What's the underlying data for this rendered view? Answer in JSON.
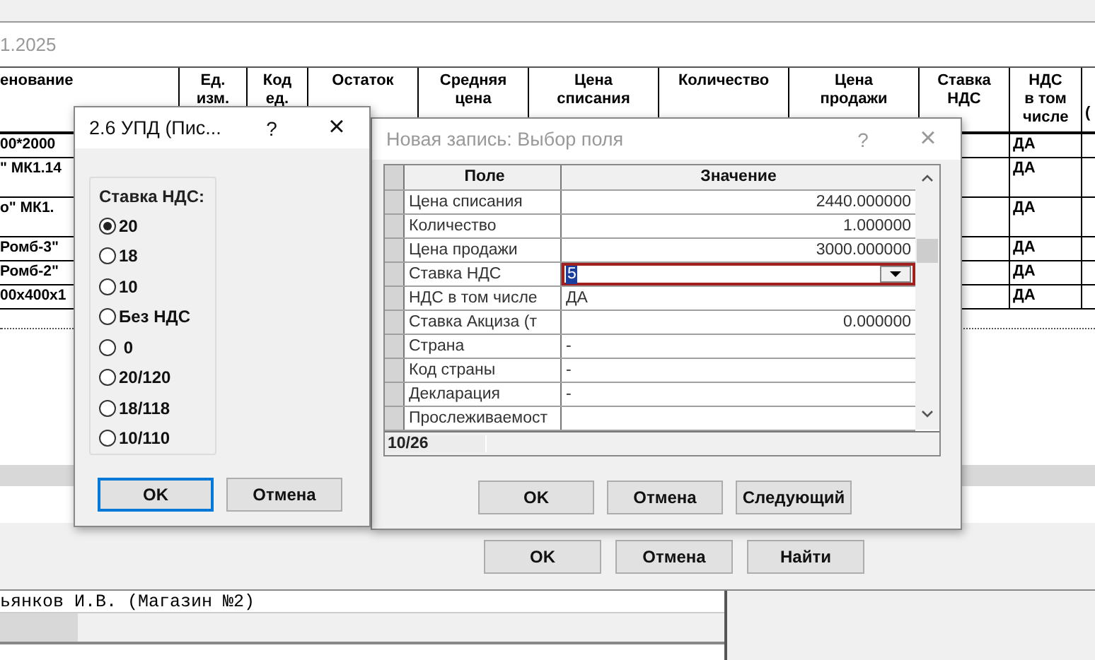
{
  "main_window": {
    "date": "1.2025",
    "table": {
      "columns": [
        "енование",
        "Ед. изм.",
        "Код ед.",
        "Остаток",
        "Средняя цена",
        "Цена списания",
        "Количество",
        "Цена продажи",
        "Ставка НДС",
        "НДС в том числе",
        "("
      ],
      "rows": [
        {
          "name": "00*2000",
          "vat_included": "ДА",
          "tall": false
        },
        {
          "name": "\" МК1.14",
          "vat_included": "ДА",
          "tall": true
        },
        {
          "name": "о\" МК1.",
          "vat_included": "ДА",
          "tall": true
        },
        {
          "name": "Ромб-3\"",
          "vat_included": "ДА",
          "tall": false
        },
        {
          "name": "Ромб-2\"",
          "vat_included": "ДА",
          "tall": false
        },
        {
          "name": "00х400х1",
          "vat_included": "ДА",
          "tall": false
        }
      ]
    },
    "buttons": [
      "OK",
      "Отмена",
      "Найти"
    ],
    "footer_text": "ьянков И.В. (Магазин №2)"
  },
  "vat_dialog": {
    "title": "2.6 УПД (Пис...",
    "help": "?",
    "close": "×",
    "group_label": "Ставка НДС:",
    "options": [
      {
        "label": "20",
        "selected": true
      },
      {
        "label": "18",
        "selected": false
      },
      {
        "label": "10",
        "selected": false
      },
      {
        "label": "Без НДС",
        "selected": false
      },
      {
        "label": " 0",
        "selected": false
      },
      {
        "label": "20/120",
        "selected": false
      },
      {
        "label": "18/118",
        "selected": false
      },
      {
        "label": "10/110",
        "selected": false
      }
    ],
    "buttons": [
      {
        "label": "OK",
        "default": true
      },
      {
        "label": "Отмена",
        "default": false
      }
    ]
  },
  "field_dialog": {
    "title": "Новая запись: Выбор поля",
    "help": "?",
    "close": "×",
    "columns": [
      "Поле",
      "Значение"
    ],
    "rows": [
      {
        "field": "Цена списания",
        "value": "2440.000000",
        "kind": "number",
        "selected": false
      },
      {
        "field": "Количество",
        "value": "1.000000",
        "kind": "number",
        "selected": false
      },
      {
        "field": "Цена продажи",
        "value": "3000.000000",
        "kind": "number",
        "selected": false
      },
      {
        "field": "Ставка НДС",
        "value": "5",
        "kind": "text",
        "selected": true
      },
      {
        "field": "НДС в том числе",
        "value": "ДА",
        "kind": "text",
        "selected": false
      },
      {
        "field": "Ставка Акциза (т",
        "value": "0.000000",
        "kind": "number",
        "selected": false
      },
      {
        "field": "Страна",
        "value": "-",
        "kind": "text",
        "selected": false
      },
      {
        "field": "Код страны",
        "value": "-",
        "kind": "text",
        "selected": false
      },
      {
        "field": "Декларация",
        "value": "-",
        "kind": "text",
        "selected": false
      },
      {
        "field": "Прослеживаемост",
        "value": "",
        "kind": "text",
        "selected": false
      }
    ],
    "record_counter": "10/26",
    "buttons": [
      "OK",
      "Отмена",
      "Следующий"
    ]
  }
}
